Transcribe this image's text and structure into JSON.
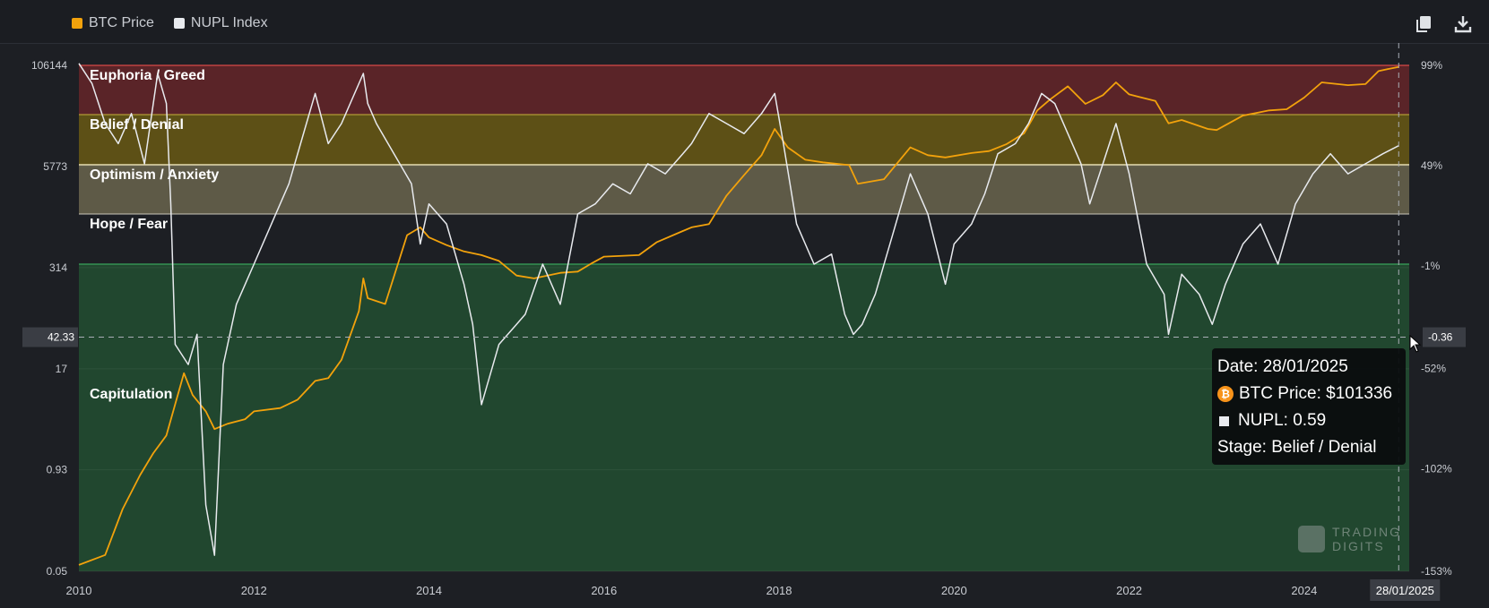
{
  "legend": [
    {
      "label": "BTC Price",
      "color": "#f2a20c"
    },
    {
      "label": "NUPL Index",
      "color": "#e8eaee"
    }
  ],
  "toolbar": {
    "icons": [
      "copy-icon",
      "download-icon"
    ]
  },
  "chart_data": {
    "type": "line",
    "x_range": [
      2010,
      2025.2
    ],
    "x_ticks": [
      "2010",
      "2012",
      "2014",
      "2016",
      "2018",
      "2020",
      "2022",
      "2024"
    ],
    "left_axis": {
      "label": "BTC Price",
      "scale": "log",
      "ticks": [
        "106144",
        "5773",
        "314",
        "17",
        "0.93",
        "0.05"
      ],
      "crosshair_label": "42.33"
    },
    "right_axis": {
      "label": "NUPL",
      "ticks": [
        "99%",
        "49%",
        "-1%",
        "-52%",
        "-102%",
        "-153%"
      ],
      "crosshair_label": "-0.36"
    },
    "zones": [
      {
        "name": "Euphoria / Greed",
        "color": "#5a2428"
      },
      {
        "name": "Belief / Denial",
        "color": "#5d5016"
      },
      {
        "name": "Optimism / Anxiety",
        "color": "#5e5a47"
      },
      {
        "name": "Hope / Fear",
        "color": "#1d1f24"
      },
      {
        "name": "Capitulation",
        "color": "#21472f"
      }
    ],
    "series": [
      {
        "name": "BTC Price",
        "color": "#f2a20c",
        "x": [
          2010.0,
          2010.3,
          2010.5,
          2010.7,
          2010.85,
          2011.0,
          2011.2,
          2011.3,
          2011.45,
          2011.55,
          2011.7,
          2011.9,
          2012.0,
          2012.3,
          2012.5,
          2012.7,
          2012.85,
          2013.0,
          2013.2,
          2013.25,
          2013.3,
          2013.5,
          2013.75,
          2013.9,
          2014.0,
          2014.2,
          2014.4,
          2014.6,
          2014.8,
          2015.0,
          2015.2,
          2015.5,
          2015.7,
          2015.85,
          2016.0,
          2016.4,
          2016.6,
          2016.9,
          2017.0,
          2017.2,
          2017.4,
          2017.6,
          2017.8,
          2017.95,
          2018.1,
          2018.3,
          2018.5,
          2018.8,
          2018.9,
          2019.2,
          2019.5,
          2019.7,
          2019.9,
          2020.2,
          2020.4,
          2020.6,
          2020.8,
          2020.95,
          2021.1,
          2021.3,
          2021.5,
          2021.7,
          2021.85,
          2022.0,
          2022.3,
          2022.45,
          2022.6,
          2022.9,
          2023.0,
          2023.3,
          2023.6,
          2023.8,
          2024.0,
          2024.2,
          2024.5,
          2024.7,
          2024.85,
          2024.95,
          2025.08
        ],
        "values": [
          0.06,
          0.08,
          0.3,
          0.8,
          1.5,
          2.5,
          15,
          8,
          5,
          3,
          3.5,
          4,
          5,
          5.5,
          7,
          12,
          13,
          22,
          90,
          230,
          130,
          110,
          800,
          1000,
          750,
          600,
          500,
          450,
          380,
          250,
          230,
          270,
          280,
          350,
          430,
          450,
          650,
          900,
          1000,
          1100,
          2500,
          4500,
          8000,
          17000,
          10000,
          7000,
          6500,
          6000,
          3500,
          4000,
          10000,
          8000,
          7500,
          8500,
          9000,
          11000,
          15000,
          29000,
          40000,
          58000,
          35000,
          45000,
          65000,
          46000,
          38000,
          20000,
          22000,
          17000,
          16500,
          25000,
          29000,
          30000,
          42000,
          65000,
          60000,
          62000,
          90000,
          95000,
          101336
        ]
      },
      {
        "name": "NUPL Index",
        "color": "#e8eaee",
        "x": [
          2010.0,
          2010.15,
          2010.3,
          2010.45,
          2010.6,
          2010.75,
          2010.9,
          2011.0,
          2011.05,
          2011.1,
          2011.25,
          2011.35,
          2011.45,
          2011.55,
          2011.65,
          2011.8,
          2011.9,
          2012.0,
          2012.2,
          2012.4,
          2012.6,
          2012.7,
          2012.85,
          2013.0,
          2013.25,
          2013.3,
          2013.4,
          2013.6,
          2013.8,
          2013.9,
          2014.0,
          2014.2,
          2014.4,
          2014.5,
          2014.6,
          2014.8,
          2015.0,
          2015.1,
          2015.3,
          2015.5,
          2015.7,
          2015.9,
          2016.1,
          2016.3,
          2016.5,
          2016.7,
          2016.9,
          2017.0,
          2017.2,
          2017.4,
          2017.6,
          2017.8,
          2017.95,
          2018.05,
          2018.2,
          2018.4,
          2018.6,
          2018.75,
          2018.85,
          2018.95,
          2019.1,
          2019.3,
          2019.5,
          2019.7,
          2019.9,
          2020.0,
          2020.2,
          2020.35,
          2020.5,
          2020.7,
          2020.85,
          2021.0,
          2021.15,
          2021.3,
          2021.45,
          2021.55,
          2021.7,
          2021.85,
          2022.0,
          2022.2,
          2022.4,
          2022.45,
          2022.6,
          2022.8,
          2022.95,
          2023.1,
          2023.3,
          2023.5,
          2023.7,
          2023.9,
          2024.1,
          2024.3,
          2024.5,
          2024.7,
          2024.9,
          2025.08
        ],
        "values": [
          1.0,
          0.9,
          0.7,
          0.6,
          0.75,
          0.5,
          0.95,
          0.8,
          0.3,
          -0.4,
          -0.5,
          -0.35,
          -1.2,
          -1.45,
          -0.5,
          -0.2,
          -0.1,
          0.0,
          0.2,
          0.4,
          0.7,
          0.85,
          0.6,
          0.7,
          0.95,
          0.8,
          0.7,
          0.55,
          0.4,
          0.1,
          0.3,
          0.2,
          -0.1,
          -0.3,
          -0.7,
          -0.4,
          -0.3,
          -0.25,
          0.0,
          -0.2,
          0.25,
          0.3,
          0.4,
          0.35,
          0.5,
          0.45,
          0.55,
          0.6,
          0.75,
          0.7,
          0.65,
          0.75,
          0.85,
          0.6,
          0.2,
          0.0,
          0.05,
          -0.25,
          -0.35,
          -0.3,
          -0.15,
          0.15,
          0.45,
          0.25,
          -0.1,
          0.1,
          0.2,
          0.35,
          0.55,
          0.6,
          0.7,
          0.85,
          0.8,
          0.65,
          0.5,
          0.3,
          0.5,
          0.7,
          0.45,
          0.0,
          -0.15,
          -0.35,
          -0.05,
          -0.15,
          -0.3,
          -0.1,
          0.1,
          0.2,
          0.0,
          0.3,
          0.45,
          0.55,
          0.45,
          0.5,
          0.55,
          0.59
        ]
      }
    ],
    "crosshair_date": "28/01/2025"
  },
  "tooltip": {
    "date": "Date: 28/01/2025",
    "btc": "BTC Price: $101336",
    "nupl": "NUPL: 0.59",
    "stage": "Stage: Belief / Denial"
  },
  "watermark": {
    "line1": "TRADING",
    "line2": "DIGITS"
  }
}
